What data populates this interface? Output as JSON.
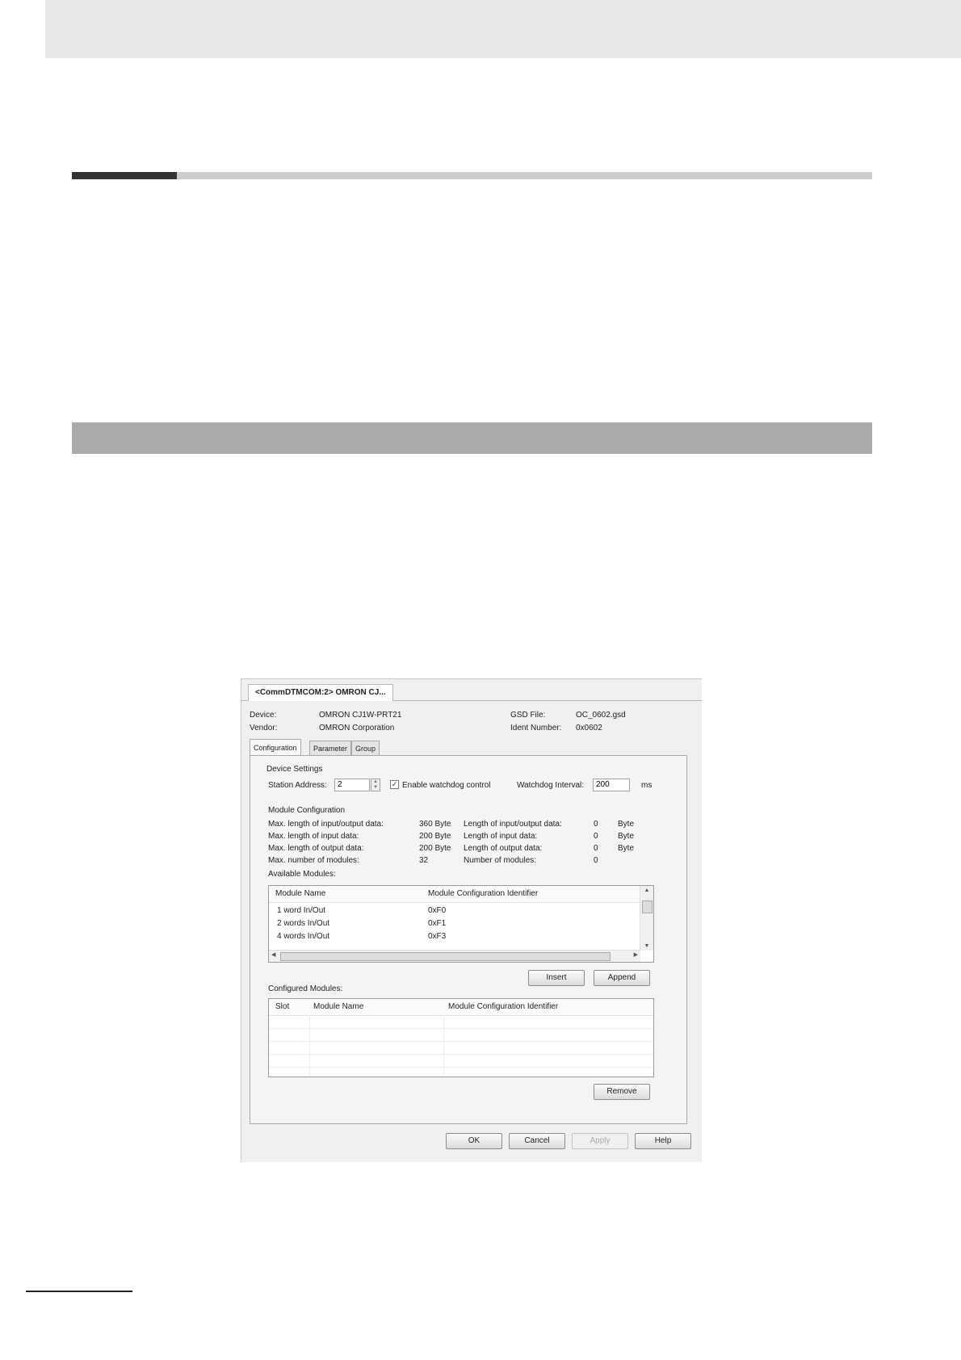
{
  "dialog": {
    "doc_tab": "<CommDTMCOM:2> OMRON CJ...",
    "device_label": "Device:",
    "device_value": "OMRON CJ1W-PRT21",
    "vendor_label": "Vendor:",
    "vendor_value": "OMRON Corporation",
    "gsd_label": "GSD File:",
    "gsd_value": "OC_0602.gsd",
    "ident_label": "Ident Number:",
    "ident_value": "0x0602",
    "tabs": [
      "Configuration",
      "Parameter",
      "Group"
    ],
    "device_settings": {
      "title": "Device Settings",
      "station_label": "Station Address:",
      "station_value": "2",
      "watchdog_label": "Enable watchdog control",
      "watchdog_checked": true,
      "interval_label": "Watchdog Interval:",
      "interval_value": "200",
      "interval_unit": "ms"
    },
    "module_config": {
      "title": "Module Configuration",
      "rows": [
        {
          "label": "Max. length of input/output data:",
          "value": "360 Byte",
          "label2": "Length of input/output data:",
          "value2": "0",
          "unit2": "Byte"
        },
        {
          "label": "Max. length of input data:",
          "value": "200 Byte",
          "label2": "Length of input data:",
          "value2": "0",
          "unit2": "Byte"
        },
        {
          "label": "Max. length of output data:",
          "value": "200 Byte",
          "label2": "Length of output data:",
          "value2": "0",
          "unit2": "Byte"
        },
        {
          "label": "Max. number of modules:",
          "value": "32",
          "label2": "Number of modules:",
          "value2": "0",
          "unit2": ""
        }
      ]
    },
    "available": {
      "title": "Available Modules:",
      "col_name": "Module Name",
      "col_id": "Module Configuration Identifier",
      "rows": [
        {
          "name": "1 word In/Out",
          "id": "0xF0"
        },
        {
          "name": "2 words In/Out",
          "id": "0xF1"
        },
        {
          "name": "4 words In/Out",
          "id": "0xF3"
        }
      ]
    },
    "insert_label": "Insert",
    "append_label": "Append",
    "configured": {
      "title": "Configured Modules:",
      "col_slot": "Slot",
      "col_name": "Module Name",
      "col_id": "Module Configuration Identifier"
    },
    "remove_label": "Remove",
    "ok_label": "OK",
    "cancel_label": "Cancel",
    "apply_label": "Apply",
    "help_label": "Help"
  }
}
